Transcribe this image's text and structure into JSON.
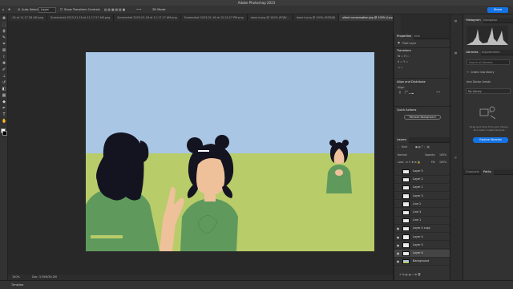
{
  "app": {
    "title": "Adobe Photoshop 2023"
  },
  "options_bar": {
    "auto_select_label": "Auto-Select:",
    "auto_select_value": "Layer",
    "transform_label": "Show Transform Controls",
    "mode_3d_label": "3D Mode:",
    "share_label": "Share"
  },
  "tabs": [
    "-16 at 11.17.28 AM.png",
    "Screenshot 2023-01-16 at 11.17.57 AM.png",
    "Screenshot 2023-01-16 at 11.17.17 AM.png",
    "Screenshot 2023-01-16 at 12.24.27 PM.png",
    "doorrrl.png @ 100% (RGB/...",
    "doorrrl.png @ 100% (RGB/8)",
    "silent conversation.jpg @ 100% (Layer 6, RGB/8)"
  ],
  "status_bar": {
    "zoom": "100%",
    "doc_info": "Doc: 3.55M/30.2M"
  },
  "timeline": {
    "label": "Timeline"
  },
  "properties_panel": {
    "tabs": [
      "Properties",
      "Info"
    ],
    "layer_kind": "Pixel Layer",
    "transform_title": "Transform",
    "align_title": "Align and Distribute",
    "align_label": "Align:",
    "quick_actions_title": "Quick Actions",
    "remove_bg_label": "Remove Background"
  },
  "layers_panel": {
    "title": "Layers",
    "kind_label": "Kind",
    "blend_mode": "Normal",
    "opacity_label": "Opacity:",
    "opacity_value": "100%",
    "lock_label": "Lock:",
    "fill_label": "Fill:",
    "fill_value": "100%",
    "layers": [
      {
        "name": "Layer 5",
        "visible": false,
        "selected": false
      },
      {
        "name": "Layer 2",
        "visible": false,
        "selected": false
      },
      {
        "name": "Layer 1",
        "visible": false,
        "selected": false
      },
      {
        "name": "Layer 3",
        "visible": false,
        "selected": false
      },
      {
        "name": "Line 2",
        "visible": false,
        "selected": false
      },
      {
        "name": "Line 3",
        "visible": false,
        "selected": false
      },
      {
        "name": "Line 1",
        "visible": false,
        "selected": false
      },
      {
        "name": "Layer 4 copy",
        "visible": true,
        "selected": false
      },
      {
        "name": "Layer 4",
        "visible": true,
        "selected": false
      },
      {
        "name": "Layer 5",
        "visible": true,
        "selected": false
      },
      {
        "name": "Layer 6",
        "visible": true,
        "selected": true
      },
      {
        "name": "Background",
        "visible": true,
        "selected": false
      }
    ]
  },
  "right_panel": {
    "histogram_tabs": [
      "Histogram",
      "Navigator"
    ],
    "libraries_tabs": [
      "Libraries",
      "Adjustments"
    ],
    "search_placeholder": "Search all libraries",
    "create_new_library": "Create new library",
    "library_owner": "Jenn Doctor Amata",
    "my_library": "My Library",
    "empty_hint": "Drag and drop from your library and easily create libraries",
    "create_button": "Explore libraries",
    "bottom_tabs": [
      "Channels",
      "Paths"
    ]
  },
  "colors": {
    "sky": "#a9c6e4",
    "grass": "#b8cc6a",
    "shirt": "#5f9a5c",
    "hair": "#141420",
    "skin": "#efc19a",
    "accent": "#1473e6"
  }
}
